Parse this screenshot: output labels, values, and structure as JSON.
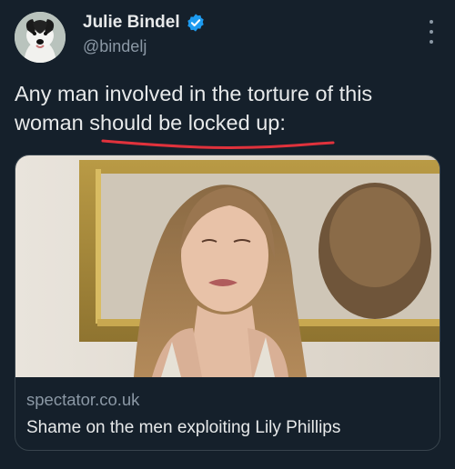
{
  "author": {
    "name": "Julie Bindel",
    "handle": "@bindelj",
    "verified": true,
    "avatar_icon": "dog-avatar"
  },
  "menu_icon": "more-vertical-icon",
  "tweet": {
    "line1": "Any man involved in the torture of this",
    "line2": "woman should be locked up:"
  },
  "link_card": {
    "domain": "spectator.co.uk",
    "title": "Shame on the men exploiting Lily Phillips",
    "image_description_icon": "article-photo"
  },
  "colors": {
    "background": "#15202b",
    "text": "#e7e9ea",
    "secondary": "#8b98a5",
    "verified_badge": "#1d9bf0",
    "annotation": "#e0323c",
    "border": "#38444d"
  }
}
